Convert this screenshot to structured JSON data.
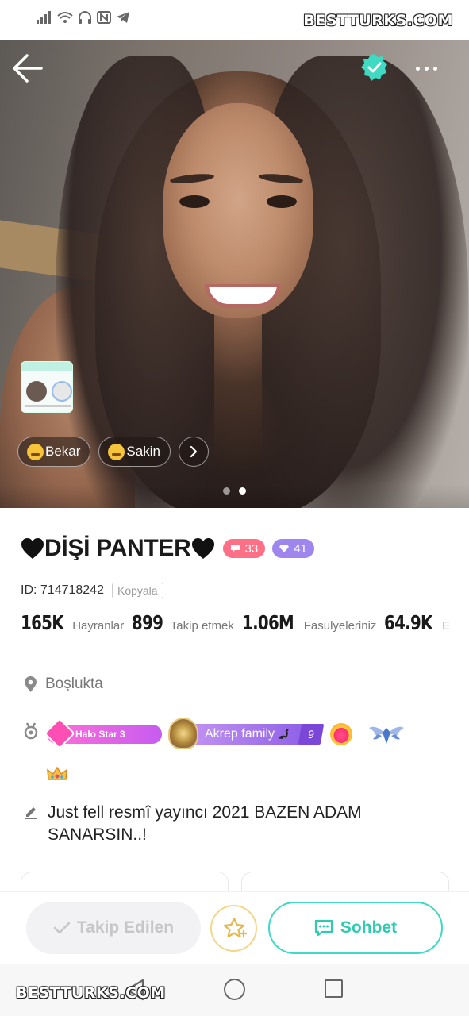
{
  "watermark": {
    "top": "BESTTURKS.COM",
    "bottom": "BESTTURKS.COM"
  },
  "status_bar": {
    "icons": [
      "signal-icon",
      "wifi-icon",
      "headphones-icon",
      "nfc-icon",
      "telegram-icon"
    ]
  },
  "hero": {
    "chips": [
      {
        "emoji": "wink-emoji",
        "label": "Bekar"
      },
      {
        "emoji": "neutral-emoji",
        "label": "Sakin"
      }
    ],
    "photo_index": 2,
    "photo_count": 2,
    "accent_color": "#3fdac1"
  },
  "profile": {
    "name": "DİŞİ PANTER",
    "badges": {
      "level": "33",
      "gems": "41"
    },
    "id_text": "ID: 714718242",
    "copy_label": "Kopyala",
    "stats": [
      {
        "value": "165K",
        "label": "Hayranlar"
      },
      {
        "value": "899",
        "label": "Takip etmek"
      },
      {
        "value": "1.06M",
        "label": "Fasulyeleriniz"
      },
      {
        "value": "64.9K",
        "label": "E"
      }
    ],
    "location": "Boşlukta",
    "halo_label": "Halo Star 3",
    "family": {
      "label": "Akrep family",
      "level": "9"
    },
    "bio": "Just fell resmî yayıncı 2021 BAZEN ADAM SANARSIN..!"
  },
  "actions": {
    "follow_label": "Takip Edilen",
    "chat_label": "Sohbet"
  },
  "colors": {
    "pink_badge": "#ff6f85",
    "purple_badge": "#9f86ef",
    "chat_accent": "#2fcbb1"
  }
}
